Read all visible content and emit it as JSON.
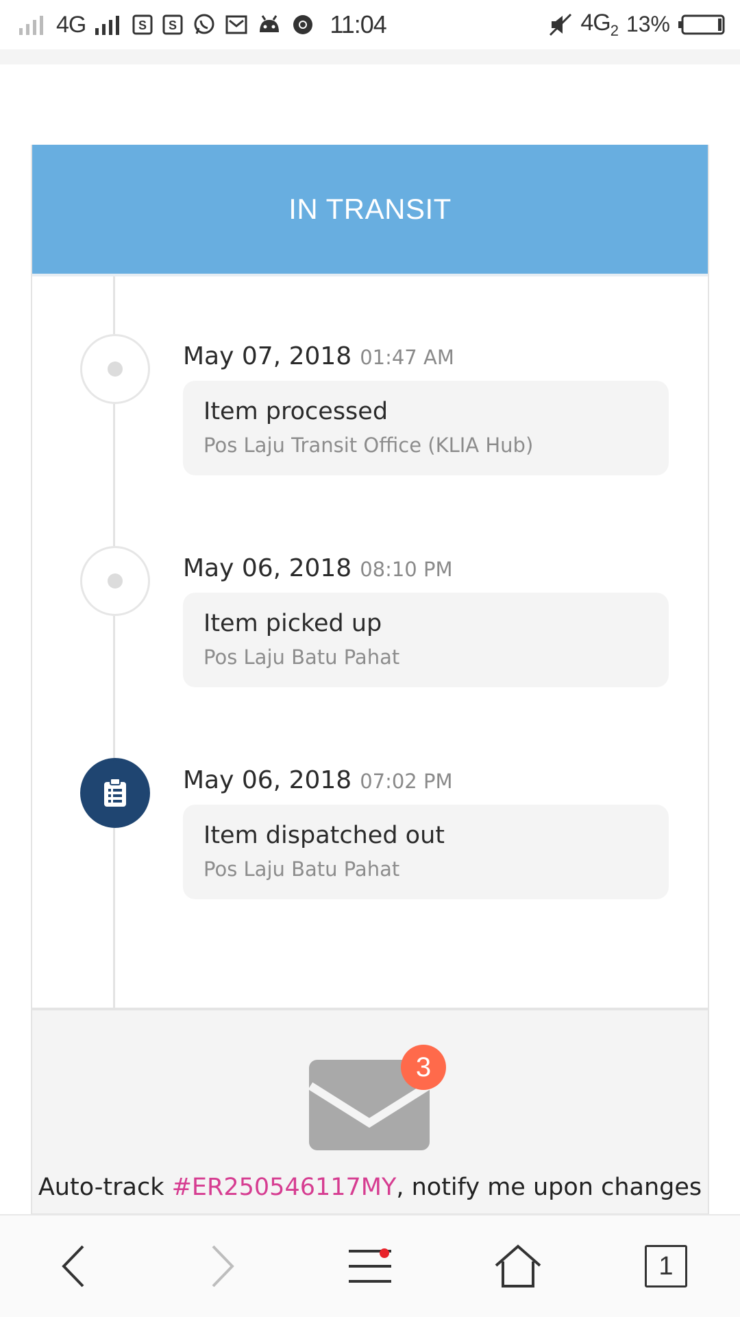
{
  "status_bar": {
    "network": "4G",
    "time": "11:04",
    "network_right": "4G",
    "sim_slot": "2",
    "battery_percent": "13%",
    "icons": [
      "signal-weak-icon",
      "signal-strong-icon",
      "s-app-icon",
      "s-app-icon",
      "whatsapp-icon",
      "mail-app-icon",
      "android-icon",
      "chrome-icon",
      "mute-icon",
      "battery-icon"
    ]
  },
  "status_header": {
    "label": "IN TRANSIT",
    "color": "#68aee0"
  },
  "events": [
    {
      "date": "May 07, 2018",
      "time": "01:47 AM",
      "title": "Item processed",
      "location": "Pos Laju Transit Office (KLIA Hub)",
      "icon": "dot-icon"
    },
    {
      "date": "May 06, 2018",
      "time": "08:10 PM",
      "title": "Item picked up",
      "location": "Pos Laju Batu Pahat",
      "icon": "dot-icon"
    },
    {
      "date": "May 06, 2018",
      "time": "07:02 PM",
      "title": "Item dispatched out",
      "location": "Pos Laju Batu Pahat",
      "icon": "clipboard-icon"
    }
  ],
  "subscribe": {
    "badge_count": "3",
    "text_before": "Auto-track ",
    "tracking_number": "#ER250546117MY",
    "text_after": ", notify me upon changes",
    "accent": "#d63d91"
  },
  "browser_nav": {
    "tab_count": "1",
    "buttons": [
      "back-icon",
      "forward-icon",
      "menu-icon",
      "home-icon",
      "tabs-icon"
    ]
  }
}
